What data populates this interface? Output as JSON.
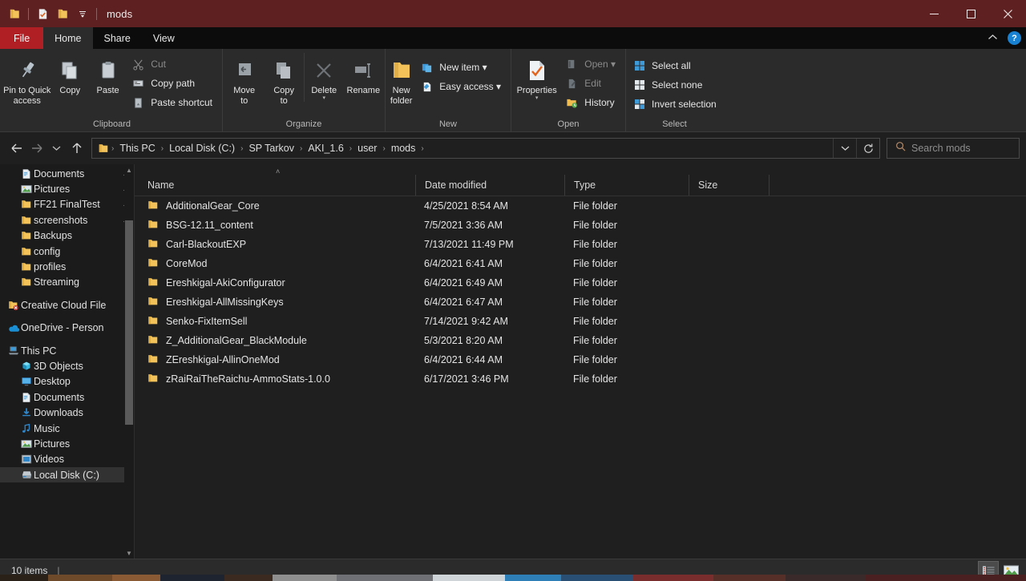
{
  "window": {
    "title": "mods",
    "quick_access": [
      "folder-icon",
      "properties-icon",
      "new-folder-icon",
      "customize-qat-dropdown-icon"
    ],
    "controls": {
      "minimize": "minimize-icon",
      "maximize": "maximize-icon",
      "close": "close-icon"
    }
  },
  "tabs": [
    {
      "label": "File",
      "kind": "file"
    },
    {
      "label": "Home",
      "kind": "active"
    },
    {
      "label": "Share",
      "kind": "normal"
    },
    {
      "label": "View",
      "kind": "normal"
    }
  ],
  "tabstrip_right": {
    "collapse_label": "˄",
    "help_label": "?"
  },
  "ribbon": {
    "groups": [
      {
        "label": "Clipboard",
        "big": [
          {
            "label_line1": "Pin to Quick",
            "label_line2": "access",
            "icon": "pin-icon"
          },
          {
            "label_line1": "Copy",
            "label_line2": "",
            "icon": "copy-icon"
          },
          {
            "label_line1": "Paste",
            "label_line2": "",
            "icon": "paste-icon"
          }
        ],
        "small": [
          {
            "label": "Cut",
            "icon": "scissors-icon",
            "dim": true
          },
          {
            "label": "Copy path",
            "icon": "copy-path-icon",
            "dim": false
          },
          {
            "label": "Paste shortcut",
            "icon": "paste-shortcut-icon",
            "dim": false
          }
        ]
      },
      {
        "label": "Organize",
        "big": [
          {
            "label_line1": "Move",
            "label_line2": "to",
            "icon": "move-to-icon",
            "caret": true
          },
          {
            "label_line1": "Copy",
            "label_line2": "to",
            "icon": "copy-to-icon",
            "caret": true
          },
          {
            "label_line1": "Delete",
            "label_line2": "",
            "icon": "delete-icon",
            "caret": true
          },
          {
            "label_line1": "Rename",
            "label_line2": "",
            "icon": "rename-icon"
          }
        ],
        "small": []
      },
      {
        "label": "New",
        "big": [
          {
            "label_line1": "New",
            "label_line2": "folder",
            "icon": "new-folder-icon"
          }
        ],
        "small": [
          {
            "label": "New item ▾",
            "icon": "new-item-icon",
            "dim": false
          },
          {
            "label": "Easy access ▾",
            "icon": "easy-access-icon",
            "dim": false
          }
        ]
      },
      {
        "label": "Open",
        "big": [
          {
            "label_line1": "Properties",
            "label_line2": "",
            "icon": "properties-icon",
            "caret": true
          }
        ],
        "small": [
          {
            "label": "Open ▾",
            "icon": "open-icon",
            "dim": true
          },
          {
            "label": "Edit",
            "icon": "edit-icon",
            "dim": true
          },
          {
            "label": "History",
            "icon": "history-icon",
            "dim": false
          }
        ]
      },
      {
        "label": "Select",
        "big": [],
        "small": [
          {
            "label": "Select all",
            "icon": "select-all-icon",
            "dim": false
          },
          {
            "label": "Select none",
            "icon": "select-none-icon",
            "dim": false
          },
          {
            "label": "Invert selection",
            "icon": "invert-selection-icon",
            "dim": false
          }
        ]
      }
    ]
  },
  "addressbar": {
    "back": "back-arrow-icon",
    "forward": "forward-arrow-icon",
    "recent": "recent-locations-dropdown-icon",
    "up": "up-arrow-icon",
    "path_icon": "folder-icon",
    "crumbs": [
      "This PC",
      "Local Disk (C:)",
      "SP Tarkov",
      "AKI_1.6",
      "user",
      "mods"
    ],
    "dropdown": "chevron-down-icon",
    "refresh": "refresh-icon",
    "search_placeholder": "Search mods",
    "search_icon": "search-icon"
  },
  "sidebar": {
    "items": [
      {
        "label": "Documents",
        "icon": "documents-icon",
        "indent": 1,
        "pinned": true
      },
      {
        "label": "Pictures",
        "icon": "pictures-icon",
        "indent": 1,
        "pinned": true
      },
      {
        "label": "FF21 FinalTest",
        "icon": "folder-icon",
        "indent": 1,
        "pinned": true
      },
      {
        "label": "screenshots",
        "icon": "folder-icon",
        "indent": 1,
        "pinned": true
      },
      {
        "label": "Backups",
        "icon": "folder-icon",
        "indent": 1,
        "pinned": false
      },
      {
        "label": "config",
        "icon": "folder-icon",
        "indent": 1,
        "pinned": false
      },
      {
        "label": "profiles",
        "icon": "folder-icon",
        "indent": 1,
        "pinned": false
      },
      {
        "label": "Streaming",
        "icon": "folder-icon",
        "indent": 1,
        "pinned": false
      },
      {
        "label": "__gap__",
        "icon": "",
        "indent": 0,
        "pinned": false
      },
      {
        "label": "Creative Cloud File",
        "icon": "creative-cloud-icon",
        "indent": 0,
        "pinned": false
      },
      {
        "label": "__gap__",
        "icon": "",
        "indent": 0,
        "pinned": false
      },
      {
        "label": "OneDrive - Person",
        "icon": "onedrive-icon",
        "indent": 0,
        "pinned": false
      },
      {
        "label": "__gap__",
        "icon": "",
        "indent": 0,
        "pinned": false
      },
      {
        "label": "This PC",
        "icon": "this-pc-icon",
        "indent": 0,
        "pinned": false
      },
      {
        "label": "3D Objects",
        "icon": "3d-objects-icon",
        "indent": 1,
        "pinned": false
      },
      {
        "label": "Desktop",
        "icon": "desktop-icon",
        "indent": 1,
        "pinned": false
      },
      {
        "label": "Documents",
        "icon": "documents-icon",
        "indent": 1,
        "pinned": false
      },
      {
        "label": "Downloads",
        "icon": "downloads-icon",
        "indent": 1,
        "pinned": false
      },
      {
        "label": "Music",
        "icon": "music-icon",
        "indent": 1,
        "pinned": false
      },
      {
        "label": "Pictures",
        "icon": "pictures-icon",
        "indent": 1,
        "pinned": false
      },
      {
        "label": "Videos",
        "icon": "videos-icon",
        "indent": 1,
        "pinned": false
      },
      {
        "label": "Local Disk (C:)",
        "icon": "local-disk-icon",
        "indent": 1,
        "pinned": false,
        "selected": true
      }
    ]
  },
  "filelist": {
    "sort_indicator": "˄",
    "columns": [
      {
        "label": "Name",
        "key": "name"
      },
      {
        "label": "Date modified",
        "key": "date"
      },
      {
        "label": "Type",
        "key": "type"
      },
      {
        "label": "Size",
        "key": "size"
      }
    ],
    "rows": [
      {
        "name": "AdditionalGear_Core",
        "date": "4/25/2021 8:54 AM",
        "type": "File folder",
        "size": "",
        "icon": "folder-icon"
      },
      {
        "name": "BSG-12.11_content",
        "date": "7/5/2021 3:36 AM",
        "type": "File folder",
        "size": "",
        "icon": "folder-icon"
      },
      {
        "name": "Carl-BlackoutEXP",
        "date": "7/13/2021 11:49 PM",
        "type": "File folder",
        "size": "",
        "icon": "folder-icon"
      },
      {
        "name": "CoreMod",
        "date": "6/4/2021 6:41 AM",
        "type": "File folder",
        "size": "",
        "icon": "folder-icon"
      },
      {
        "name": "Ereshkigal-AkiConfigurator",
        "date": "6/4/2021 6:49 AM",
        "type": "File folder",
        "size": "",
        "icon": "folder-icon"
      },
      {
        "name": "Ereshkigal-AllMissingKeys",
        "date": "6/4/2021 6:47 AM",
        "type": "File folder",
        "size": "",
        "icon": "folder-icon"
      },
      {
        "name": "Senko-FixItemSell",
        "date": "7/14/2021 9:42 AM",
        "type": "File folder",
        "size": "",
        "icon": "folder-icon"
      },
      {
        "name": "Z_AdditionalGear_BlackModule",
        "date": "5/3/2021 8:20 AM",
        "type": "File folder",
        "size": "",
        "icon": "folder-icon"
      },
      {
        "name": "ZEreshkigal-AllinOneMod",
        "date": "6/4/2021 6:44 AM",
        "type": "File folder",
        "size": "",
        "icon": "folder-icon"
      },
      {
        "name": "zRaiRaiTheRaichu-AmmoStats-1.0.0",
        "date": "6/17/2021 3:46 PM",
        "type": "File folder",
        "size": "",
        "icon": "folder-icon"
      }
    ]
  },
  "statusbar": {
    "item_count": "10 items",
    "separator": "|",
    "views": [
      {
        "name": "details-view",
        "active": true
      },
      {
        "name": "large-icons-view",
        "active": false
      }
    ]
  },
  "colors": {
    "titlebar": "#5e2020",
    "file_tab": "#b01f24",
    "ribbon": "#2b2b2b",
    "content": "#1f1f1f",
    "sidebar": "#1b1b1b",
    "folder_yellow": "#f5c453",
    "accent_blue": "#1881d2",
    "selected_row": "#323232"
  }
}
